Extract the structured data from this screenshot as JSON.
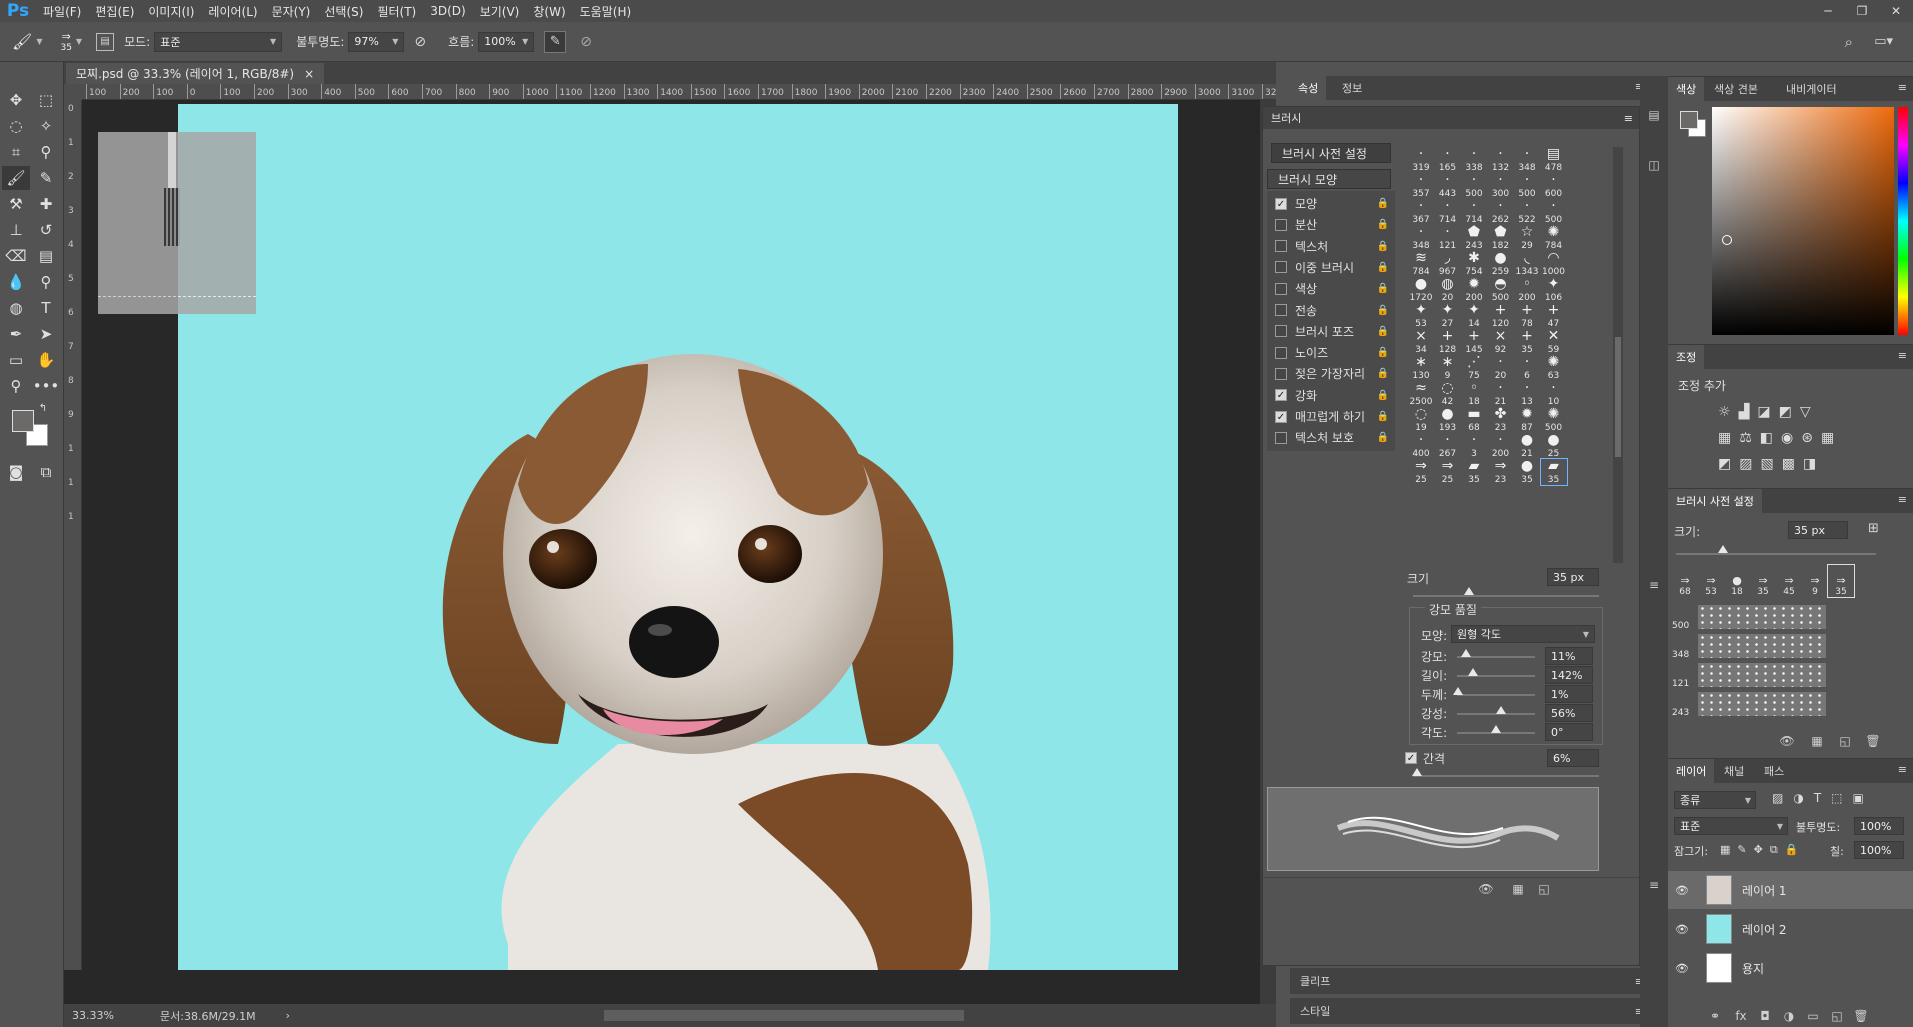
{
  "menubar": {
    "logo": "Ps",
    "items": [
      "파일(F)",
      "편집(E)",
      "이미지(I)",
      "레이어(L)",
      "문자(Y)",
      "선택(S)",
      "필터(T)",
      "3D(D)",
      "보기(V)",
      "창(W)",
      "도움말(H)"
    ],
    "window_min": "─",
    "window_restore": "❐",
    "window_close": "✕"
  },
  "options": {
    "brush_size": "35",
    "mode_label": "모드:",
    "mode_value": "표준",
    "opacity_label": "불투명도:",
    "opacity_value": "97%",
    "flow_label": "흐름:",
    "flow_value": "100%"
  },
  "document": {
    "tab_title": "모찌.psd @ 33.3% (레이어 1, RGB/8#)",
    "tab_close": "×",
    "ruler_ticks": [
      "100",
      "200",
      "100",
      "0",
      "100",
      "200",
      "300",
      "400",
      "500",
      "600",
      "700",
      "800",
      "900",
      "1000",
      "1100",
      "1200",
      "1300",
      "1400",
      "1500",
      "1600",
      "1700",
      "1800",
      "1900",
      "2000",
      "2100",
      "2200",
      "2300",
      "2400",
      "2500",
      "2600",
      "2700",
      "2800",
      "2900",
      "3000",
      "3100",
      "320"
    ],
    "ruler_v_ticks": [
      "0",
      "1",
      "2",
      "3",
      "4",
      "5",
      "6",
      "7",
      "8",
      "9",
      "1",
      "1",
      "1"
    ],
    "zoom": "33.33%",
    "doc_size": "문서:38.6M/29.1M",
    "status_arrow": "›"
  },
  "panel_tabs": {
    "properties": "속성",
    "info": "정보",
    "color": "색상",
    "swatches": "색상 견본",
    "navigator": "내비게이터"
  },
  "brush_panel": {
    "title": "브러시",
    "preset_button": "브러시 사전 설정",
    "tip_shape_button": "브러시 모양",
    "options": [
      {
        "label": "모양",
        "checked": true
      },
      {
        "label": "분산",
        "checked": false
      },
      {
        "label": "텍스처",
        "checked": false
      },
      {
        "label": "이중 브러시",
        "checked": false
      },
      {
        "label": "색상",
        "checked": false
      },
      {
        "label": "전송",
        "checked": false
      },
      {
        "label": "브러시 포즈",
        "checked": false
      },
      {
        "label": "노이즈",
        "checked": false
      },
      {
        "label": "젖은 가장자리",
        "checked": false
      },
      {
        "label": "강화",
        "checked": true
      },
      {
        "label": "매끄럽게 하기",
        "checked": true
      },
      {
        "label": "텍스처 보호",
        "checked": false
      }
    ],
    "tip_sizes": [
      "319",
      "165",
      "338",
      "132",
      "348",
      "478",
      "357",
      "443",
      "500",
      "300",
      "500",
      "600",
      "367",
      "714",
      "714",
      "262",
      "522",
      "500",
      "348",
      "121",
      "243",
      "182",
      "29",
      "784",
      "784",
      "967",
      "754",
      "259",
      "1343",
      "1000",
      "1720",
      "20",
      "200",
      "500",
      "200",
      "106",
      "53",
      "27",
      "14",
      "120",
      "78",
      "47",
      "34",
      "128",
      "145",
      "92",
      "35",
      "59",
      "130",
      "9",
      "75",
      "20",
      "6",
      "63",
      "2500",
      "42",
      "18",
      "21",
      "13",
      "10",
      "19",
      "193",
      "68",
      "23",
      "87",
      "500",
      "400",
      "267",
      "3",
      "200",
      "21",
      "25",
      "25",
      "25",
      "35",
      "23",
      "35",
      "35"
    ],
    "tip_glyphs": [
      "·",
      "·",
      "·",
      "·",
      "·",
      "▤",
      "·",
      "·",
      "·",
      "·",
      "·",
      "·",
      "·",
      "·",
      "·",
      "·",
      "·",
      "·",
      "·",
      "·",
      "⬟",
      "⬟",
      "☆",
      "✺",
      "≋",
      "◞",
      "✱",
      "●",
      "◟",
      "◠",
      "●",
      "◍",
      "✹",
      "◓",
      "◦",
      "✦",
      "✦",
      "✦",
      "✦",
      "+",
      "+",
      "+",
      "×",
      "+",
      "+",
      "×",
      "+",
      "✕",
      "∗",
      "∗",
      "⋰",
      "·",
      "·",
      "✺",
      "≈",
      "◌",
      "◦",
      "·",
      "·",
      "·",
      "◌",
      "●",
      "▬",
      "✤",
      "✹",
      "✺",
      "·",
      "·",
      "·",
      "·",
      "●",
      "●",
      "⇒",
      "⇒",
      "▰",
      "⇒",
      "●",
      "▰"
    ],
    "size_label": "크기",
    "size_value": "35 px",
    "pen_pressure_label": "강모 품질",
    "shape_label": "모양:",
    "shape_value": "원형 각도",
    "bristles_label": "강모:",
    "bristles_value": "11%",
    "length_label": "길이:",
    "length_value": "142%",
    "thickness_label": "두께:",
    "thickness_value": "1%",
    "stiffness_label": "강성:",
    "stiffness_value": "56%",
    "angle_label": "각도:",
    "angle_value": "0°",
    "spacing_label": "간격",
    "spacing_value": "6%",
    "levels": {
      "size": 0.3,
      "bristles": 0.11,
      "length": 0.21,
      "thickness": 0.01,
      "stiffness": 0.56,
      "angle": 0.5,
      "spacing": 0.02
    }
  },
  "collapsed_panels": {
    "clip": "클리프",
    "style": "스타일"
  },
  "adjustments": {
    "title": "조정",
    "add_label": "조정 추가"
  },
  "brush_presets": {
    "title": "브러시 사전 설정",
    "size_label": "크기:",
    "size_value": "35 px",
    "sizes": [
      "68",
      "53",
      "18",
      "35",
      "45",
      "9",
      "35"
    ],
    "stroke_sizes": [
      "500",
      "348",
      "121",
      "243"
    ]
  },
  "layers": {
    "tabs": [
      "레이어",
      "채널",
      "패스"
    ],
    "filter_label": "종류",
    "blend_mode": "표준",
    "opacity_label": "불투명도:",
    "opacity_value": "100%",
    "lock_label": "잠그기:",
    "fill_label": "칠:",
    "fill_value": "100%",
    "items": [
      {
        "name": "레이어 1",
        "thumb": "#d9d2cc"
      },
      {
        "name": "레이어 2",
        "thumb": "#8ee6e8"
      },
      {
        "name": "용지",
        "thumb": "#ffffff"
      }
    ]
  },
  "colors": {
    "canvas_bg": "#8ee6e8",
    "accent_blue": "#31a8ff",
    "fg_swatch": "#6b6a68",
    "bg_swatch": "#ffffff"
  }
}
